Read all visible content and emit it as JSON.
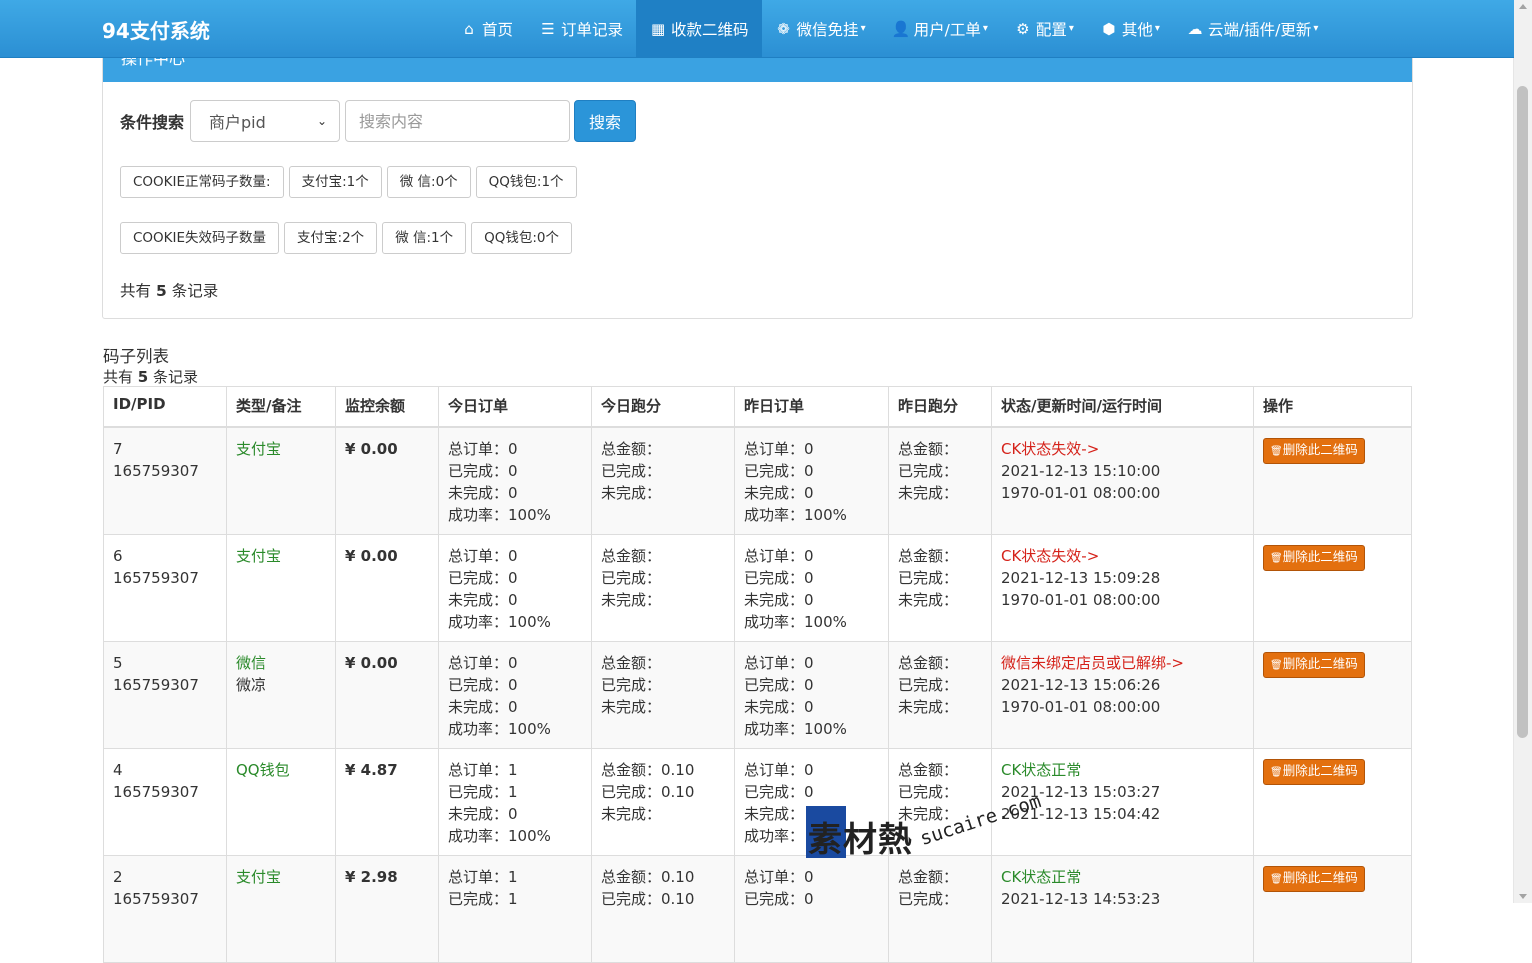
{
  "brand": "94支付系统",
  "nav": [
    {
      "icon": "home-icon",
      "glyph": "⌂",
      "label": "首页",
      "dropdown": false,
      "active": false
    },
    {
      "icon": "list-icon",
      "glyph": "☰",
      "label": "订单记录",
      "dropdown": false,
      "active": false
    },
    {
      "icon": "qrcode-icon",
      "glyph": "▦",
      "label": "收款二维码",
      "dropdown": false,
      "active": true
    },
    {
      "icon": "wechat-icon",
      "glyph": "❁",
      "label": "微信免挂",
      "dropdown": true,
      "active": false
    },
    {
      "icon": "user-icon",
      "glyph": "👤",
      "label": "用户/工单",
      "dropdown": true,
      "active": false
    },
    {
      "icon": "gear-icon",
      "glyph": "⚙",
      "label": "配置",
      "dropdown": true,
      "active": false
    },
    {
      "icon": "box-icon",
      "glyph": "⬢",
      "label": "其他",
      "dropdown": true,
      "active": false
    },
    {
      "icon": "cloud-icon",
      "glyph": "☁",
      "label": "云端/插件/更新",
      "dropdown": true,
      "active": false
    }
  ],
  "panel": {
    "heading": "操作中心",
    "search_label": "条件搜索",
    "select_value": "商户pid",
    "search_placeholder": "搜索内容",
    "search_button": "搜索",
    "cookie_ok": [
      "COOKIE正常码子数量:",
      "支付宝:1个",
      "微 信:0个",
      "QQ钱包:1个"
    ],
    "cookie_bad": [
      "COOKIE失效码子数量",
      "支付宝:2个",
      "微 信:1个",
      "QQ钱包:0个"
    ],
    "total_prefix": "共有",
    "total_count": "5",
    "total_suffix": "条记录"
  },
  "list": {
    "title": "码子列表",
    "total_prefix": "共有",
    "total_count": "5",
    "total_suffix": "条记录",
    "headers": [
      "ID/PID",
      "类型/备注",
      "监控余额",
      "今日订单",
      "今日跑分",
      "昨日订单",
      "昨日跑分",
      "状态/更新时间/运行时间",
      "操作"
    ],
    "rows": [
      {
        "id": "7",
        "pid": "165759307",
        "type": "支付宝",
        "note": "",
        "balance": "¥ 0.00",
        "today_orders": [
          "总订单：0",
          "已完成：0",
          "未完成：0",
          "成功率：100%"
        ],
        "today_score": [
          "总金额：",
          "已完成：",
          "未完成："
        ],
        "yest_orders": [
          "总订单：0",
          "已完成：0",
          "未完成：0",
          "成功率：100%"
        ],
        "yest_score": [
          "总金额：",
          "已完成：",
          "未完成："
        ],
        "status": "CK状态失效->",
        "status_ok": false,
        "updated": "2021-12-13 15:10:00",
        "run": "1970-01-01 08:00:00",
        "action": "删除此二维码"
      },
      {
        "id": "6",
        "pid": "165759307",
        "type": "支付宝",
        "note": "",
        "balance": "¥ 0.00",
        "today_orders": [
          "总订单：0",
          "已完成：0",
          "未完成：0",
          "成功率：100%"
        ],
        "today_score": [
          "总金额：",
          "已完成：",
          "未完成："
        ],
        "yest_orders": [
          "总订单：0",
          "已完成：0",
          "未完成：0",
          "成功率：100%"
        ],
        "yest_score": [
          "总金额：",
          "已完成：",
          "未完成："
        ],
        "status": "CK状态失效->",
        "status_ok": false,
        "updated": "2021-12-13 15:09:28",
        "run": "1970-01-01 08:00:00",
        "action": "删除此二维码"
      },
      {
        "id": "5",
        "pid": "165759307",
        "type": "微信",
        "note": "微凉",
        "balance": "¥ 0.00",
        "today_orders": [
          "总订单：0",
          "已完成：0",
          "未完成：0",
          "成功率：100%"
        ],
        "today_score": [
          "总金额：",
          "已完成：",
          "未完成："
        ],
        "yest_orders": [
          "总订单：0",
          "已完成：0",
          "未完成：0",
          "成功率：100%"
        ],
        "yest_score": [
          "总金额：",
          "已完成：",
          "未完成："
        ],
        "status": "微信未绑定店员或已解绑->",
        "status_ok": false,
        "updated": "2021-12-13 15:06:26",
        "run": "1970-01-01 08:00:00",
        "action": "删除此二维码"
      },
      {
        "id": "4",
        "pid": "165759307",
        "type": "QQ钱包",
        "note": "",
        "balance": "¥ 4.87",
        "today_orders": [
          "总订单：1",
          "已完成：1",
          "未完成：0",
          "成功率：100%"
        ],
        "today_score": [
          "总金额：0.10",
          "已完成：0.10",
          "未完成："
        ],
        "yest_orders": [
          "总订单：0",
          "已完成：0",
          "未完成：",
          "成功率："
        ],
        "yest_score": [
          "总金额：",
          "已完成：",
          "未完成："
        ],
        "status": "CK状态正常",
        "status_ok": true,
        "updated": "2021-12-13 15:03:27",
        "run": "2021-12-13 15:04:42",
        "action": "删除此二维码"
      },
      {
        "id": "2",
        "pid": "165759307",
        "type": "支付宝",
        "note": "",
        "balance": "¥ 2.98",
        "today_orders": [
          "总订单：1",
          "已完成：1"
        ],
        "today_score": [
          "总金额：0.10",
          "已完成：0.10"
        ],
        "yest_orders": [
          "总订单：0",
          "已完成：0"
        ],
        "yest_score": [
          "总金额：",
          "已完成："
        ],
        "status": "CK状态正常",
        "status_ok": true,
        "updated": "2021-12-13 14:53:23",
        "run": "",
        "action": "删除此二维码"
      }
    ]
  },
  "watermark": {
    "main": "素材熱",
    "sub": "sucaire.com"
  },
  "colors": {
    "nav": "#3aa2e2",
    "active": "#1f80c5",
    "green": "#2a8a2a",
    "red": "#d5221a",
    "danger_btn": "#e3700f"
  }
}
